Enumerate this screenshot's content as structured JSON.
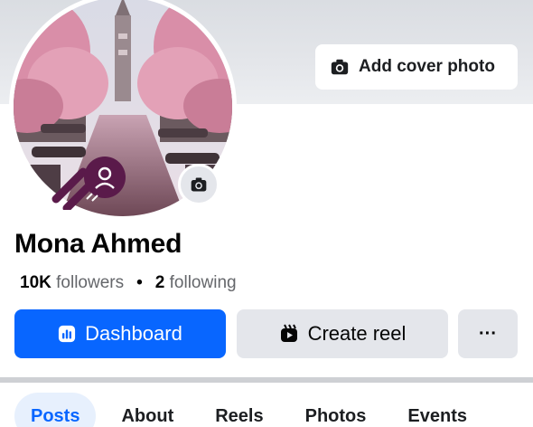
{
  "profile": {
    "name": "Mona Ahmed",
    "followers_count": "10K",
    "followers_label": "followers",
    "separator": "•",
    "following_count": "2",
    "following_label": "following"
  },
  "cover": {
    "add_cover_label": "Add cover photo",
    "icon": "camera-icon"
  },
  "avatar": {
    "camera_icon": "camera-icon",
    "badge_icon": "digital-creator-badge-icon"
  },
  "actions": {
    "dashboard_label": "Dashboard",
    "dashboard_icon": "dashboard-icon",
    "create_reel_label": "Create reel",
    "create_reel_icon": "reel-icon",
    "more_label": "···"
  },
  "tabs": [
    {
      "label": "Posts",
      "active": true
    },
    {
      "label": "About",
      "active": false
    },
    {
      "label": "Reels",
      "active": false
    },
    {
      "label": "Photos",
      "active": false
    },
    {
      "label": "Events",
      "active": false
    }
  ],
  "colors": {
    "primary": "#0866ff",
    "secondary_bg": "#e4e6eb",
    "active_tab_bg": "#e7f0fd",
    "badge": "#5a1a4a"
  }
}
